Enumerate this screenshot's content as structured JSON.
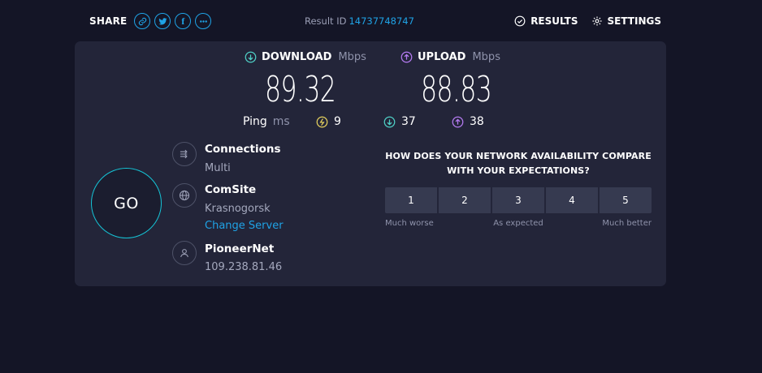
{
  "share": {
    "label": "SHARE",
    "buttons": [
      "link-icon",
      "twitter-icon",
      "facebook-icon",
      "more-icon"
    ],
    "facebook_glyph": "f"
  },
  "result": {
    "label": "Result ID",
    "id": "14737748747"
  },
  "nav": {
    "results_label": "RESULTS",
    "settings_label": "SETTINGS"
  },
  "download": {
    "label": "DOWNLOAD",
    "unit": "Mbps",
    "value": "89.32",
    "color": "#4fd0c6"
  },
  "upload": {
    "label": "UPLOAD",
    "unit": "Mbps",
    "value": "88.83",
    "color": "#b57bf2"
  },
  "ping": {
    "label": "Ping",
    "unit": "ms",
    "idle": "9",
    "download": "37",
    "upload": "38",
    "idle_color": "#e5d15e"
  },
  "go_label": "GO",
  "connections": {
    "title": "Connections",
    "value": "Multi"
  },
  "server": {
    "title": "ComSite",
    "location": "Krasnogorsk",
    "change_label": "Change Server"
  },
  "isp": {
    "title": "PioneerNet",
    "ip": "109.238.81.46"
  },
  "survey": {
    "question": "HOW DOES YOUR NETWORK AVAILABILITY COMPARE WITH YOUR EXPECTATIONS?",
    "options": [
      "1",
      "2",
      "3",
      "4",
      "5"
    ],
    "low_label": "Much worse",
    "mid_label": "As expected",
    "high_label": "Much better"
  },
  "colors": {
    "accent": "#1fa3e6",
    "go_ring": "#15c4d6",
    "background": "#141526",
    "card": "#232539"
  }
}
